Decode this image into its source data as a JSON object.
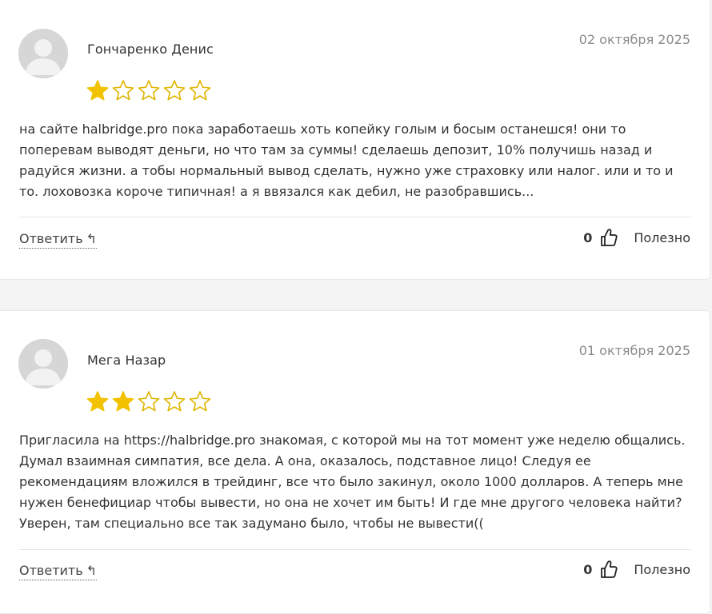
{
  "colors": {
    "star_filled": "#f2c200",
    "star_empty_stroke": "#e0b500",
    "date": "#8a8a8a",
    "text": "#333333"
  },
  "reviews": [
    {
      "author": "Гончаренко Денис",
      "date": "02 октября 2025",
      "rating": 1,
      "max_rating": 5,
      "text": "на сайте halbridge.pro пока заработаешь хоть копейку голым и босым останешся! они то поперевам выводят деньги, но что там за суммы! сделаешь депозит, 10% получишь назад и радуйся жизни. а тобы нормальный вывод сделать, нужно уже страховку или налог. или и то и то. лоховозка короче типичная! а я ввязался как дебил, не разобравшись...",
      "reply_label": "Ответить",
      "reply_icon": "reply-arrow-icon",
      "helpful_count": "0",
      "helpful_icon": "thumbs-up-icon",
      "helpful_label": "Полезно"
    },
    {
      "author": "Мега Назар",
      "date": "01 октября 2025",
      "rating": 2,
      "max_rating": 5,
      "text": "Пригласила на https://halbridge.pro знакомая, с которой мы на тот момент уже неделю общались. Думал взаимная симпатия, все дела. А она, оказалось, подставное лицо! Следуя ее рекомендациям вложился в трейдинг, все что было закинул, около 1000 долларов. А теперь мне нужен бенефициар чтобы вывести, но она не хочет им быть! И где мне другого человека найти? Уверен, там специально все так задумано было, чтобы не вывести((",
      "reply_label": "Ответить",
      "reply_icon": "reply-arrow-icon",
      "helpful_count": "0",
      "helpful_icon": "thumbs-up-icon",
      "helpful_label": "Полезно"
    }
  ]
}
